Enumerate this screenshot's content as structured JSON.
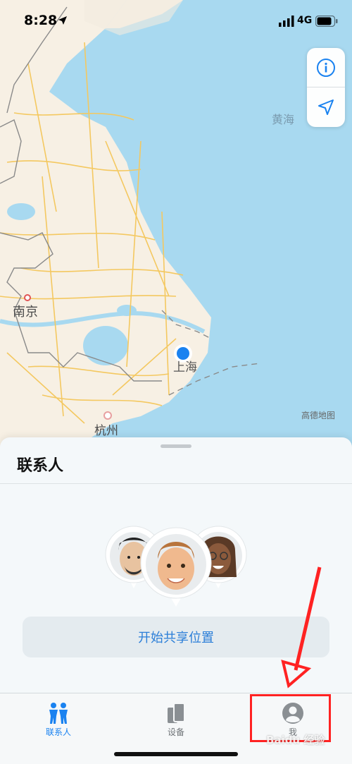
{
  "status_bar": {
    "time": "8:28",
    "network": "4G"
  },
  "map": {
    "labels": {
      "sea": "黄海",
      "nanjing": "南京",
      "shanghai": "上海",
      "hangzhou": "杭州",
      "provider": "高德地图"
    },
    "colors": {
      "water": "#a8d9f0",
      "land": "#f7f0e4",
      "road": "#f4c860",
      "accent": "#1a82f0"
    }
  },
  "sheet": {
    "title": "联系人",
    "share_button": "开始共享位置"
  },
  "tabbar": {
    "tabs": [
      {
        "label": "联系人",
        "icon": "people-icon",
        "active": true
      },
      {
        "label": "设备",
        "icon": "devices-icon",
        "active": false
      },
      {
        "label": "我",
        "icon": "person-icon",
        "active": false
      }
    ]
  },
  "watermark": "Baidu 经验"
}
